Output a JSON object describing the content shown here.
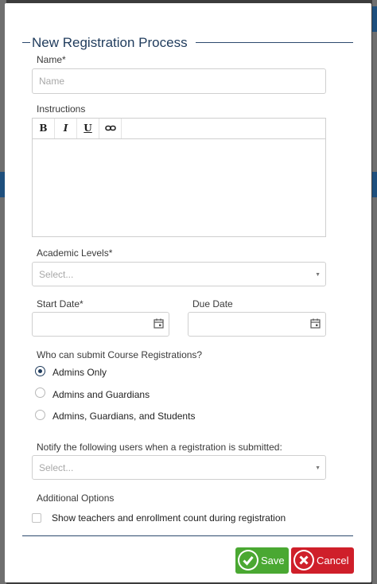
{
  "dialog": {
    "title": "New Registration Process",
    "name": {
      "label": "Name*",
      "placeholder": "Name",
      "value": ""
    },
    "instructions": {
      "label": "Instructions",
      "toolbar": {
        "bold": "B",
        "italic": "I",
        "underline": "U",
        "link_icon": "link-icon"
      },
      "value": ""
    },
    "academic_levels": {
      "label": "Academic Levels*",
      "placeholder": "Select..."
    },
    "start_date": {
      "label": "Start Date*",
      "value": ""
    },
    "due_date": {
      "label": "Due Date",
      "value": ""
    },
    "who_can_submit": {
      "label": "Who can submit Course Registrations?",
      "options": [
        {
          "label": "Admins Only",
          "selected": true
        },
        {
          "label": "Admins and Guardians",
          "selected": false
        },
        {
          "label": "Admins, Guardians, and Students",
          "selected": false
        }
      ]
    },
    "notify": {
      "label": "Notify the following users when a registration is submitted:",
      "placeholder": "Select..."
    },
    "additional_options": {
      "label": "Additional Options",
      "show_teachers": {
        "label": "Show teachers and enrollment count during registration",
        "checked": false
      }
    },
    "buttons": {
      "save": "Save",
      "cancel": "Cancel"
    }
  },
  "colors": {
    "title": "#1f3b5c",
    "save": "#4aa832",
    "cancel": "#cf1f2a"
  }
}
